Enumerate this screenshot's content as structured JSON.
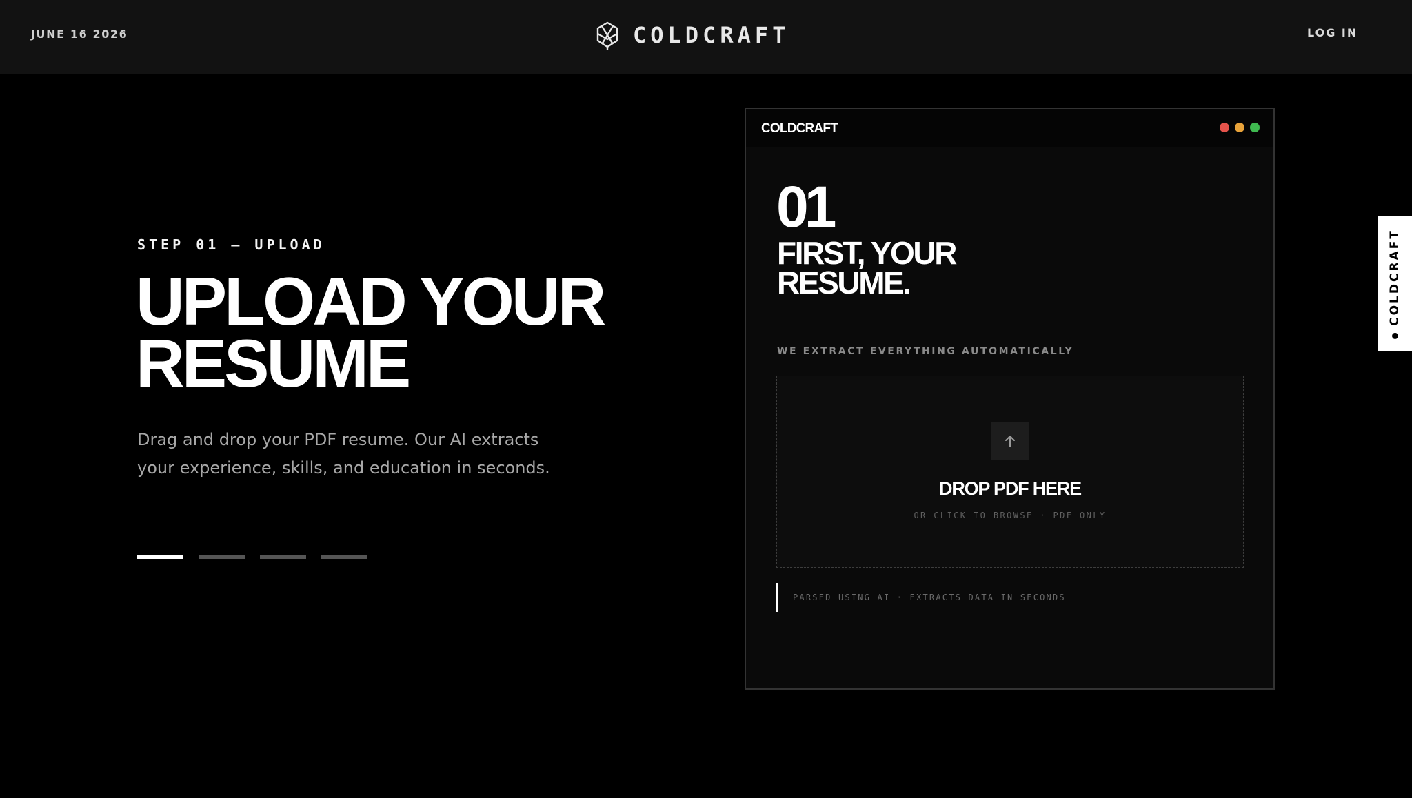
{
  "header": {
    "date": "JUNE 16 2026",
    "brand_name": "COLDCRAFT",
    "brand_icon": "crystal-logo-icon",
    "login_label": "LOG IN"
  },
  "hero": {
    "step_label": "STEP 01 — UPLOAD",
    "headline_line1": "UPLOAD YOUR",
    "headline_line2": "RESUME",
    "description": "Drag and drop your PDF resume. Our AI extracts your experience, skills, and education in seconds.",
    "progress": {
      "total_steps": 4,
      "current_step": 1
    }
  },
  "preview": {
    "window_title": "COLDCRAFT",
    "window_dots": [
      "#e5534b",
      "#e8a33a",
      "#3fb950"
    ],
    "step_number": "01",
    "heading_line1": "FIRST, YOUR",
    "heading_line2": "RESUME.",
    "extract_label": "WE EXTRACT EVERYTHING AUTOMATICALLY",
    "dropzone": {
      "icon": "arrow-up-icon",
      "title": "DROP PDF HERE",
      "subtitle": "OR CLICK TO BROWSE · PDF ONLY"
    },
    "parsed_note": "PARSED USING AI · EXTRACTS DATA IN SECONDS"
  },
  "side_tab": {
    "label": "COLDCRAFT"
  },
  "colors": {
    "background": "#000000",
    "header_bg": "#121212",
    "accent": "#ffffff",
    "muted_text": "#a8a8a8"
  }
}
